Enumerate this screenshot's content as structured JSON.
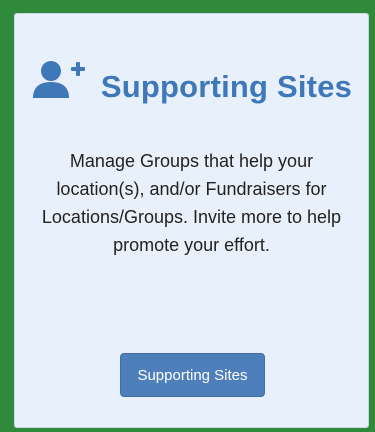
{
  "card": {
    "icon": "add-user-icon",
    "title": "Supporting Sites",
    "description": "Manage Groups that help your location(s), and/or Fundraisers for Locations/Groups. Invite more to help promote your effort.",
    "button_label": "Supporting Sites"
  },
  "colors": {
    "background_border": "#2f8a3c",
    "card_background": "#e8f0fb",
    "title": "#3f78b9",
    "button": "#4f7fba"
  }
}
